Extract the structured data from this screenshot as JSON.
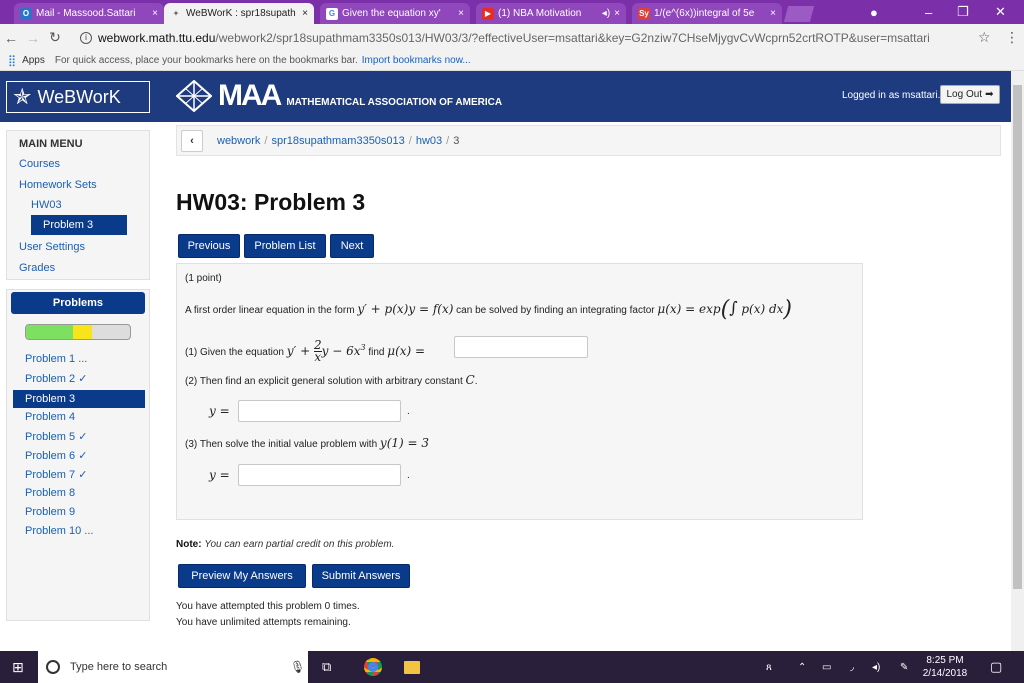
{
  "browser": {
    "tabs": [
      {
        "title": "Mail - Massood.Sattari",
        "icon": "outlook-icon"
      },
      {
        "title": "WeBWorK : spr18supath",
        "icon": "webwork-icon"
      },
      {
        "title": "Given the equation xy'",
        "icon": "google-icon"
      },
      {
        "title": "(1) NBA Motivation",
        "icon": "youtube-icon"
      },
      {
        "title": "1/(e^(6x))integral of 5e",
        "icon": "symbolab-icon"
      }
    ],
    "url_host": "webwork.math.ttu.edu",
    "url_path": "/webwork2/spr18supathmam3350s013/HW03/3/?effectiveUser=msattari&key=G2nziw7CHseMjygvCvWcprn52crtROTP&user=msattari",
    "bookmarks_apps": "Apps",
    "bookmarks_hint": "For quick access, place your bookmarks here on the bookmarks bar.",
    "bookmarks_link": "Import bookmarks now..."
  },
  "header": {
    "logo": "WeBWorK",
    "maa_big": "MAA",
    "maa_small": "MATHEMATICAL ASSOCIATION OF AMERICA",
    "logged_in": "Logged in as msattari.",
    "logout": "Log Out"
  },
  "sidebar": {
    "heading": "MAIN MENU",
    "courses": "Courses",
    "homework_sets": "Homework Sets",
    "hw03": "HW03",
    "problem3": "Problem 3",
    "user_settings": "User Settings",
    "grades": "Grades"
  },
  "problems_panel": {
    "heading": "Problems",
    "progress_correct": 0.45,
    "progress_partial": 0.18,
    "items": [
      "Problem 1 ...",
      "Problem 2 ✓",
      "Problem 3",
      "Problem 4",
      "Problem 5 ✓",
      "Problem 6 ✓",
      "Problem 7 ✓",
      "Problem 8",
      "Problem 9",
      "Problem 10 ..."
    ]
  },
  "breadcrumb": {
    "webwork": "webwork",
    "course": "spr18supathmam3350s013",
    "set": "hw03",
    "problem": "3"
  },
  "main": {
    "title": "HW03: Problem 3",
    "previous": "Previous",
    "problem_list": "Problem List",
    "next": "Next",
    "points": "(1 point)",
    "intro": "A first order linear equation in the form",
    "intro2": "can be solved by finding an integrating factor",
    "q1": "(1) Given the equation",
    "q1b": "find",
    "q2": "(2) Then find an explicit general solution with arbitrary constant",
    "q3": "(3) Then solve the initial value problem with",
    "answer1": "",
    "answer2": "",
    "answer3": "",
    "note_bold": "Note:",
    "note_text": "You can earn partial credit on this problem.",
    "preview": "Preview My Answers",
    "submit": "Submit Answers",
    "attempted": "You have attempted this problem 0 times.",
    "unlimited": "You have unlimited attempts remaining."
  },
  "taskbar": {
    "search_placeholder": "Type here to search",
    "time": "8:25 PM",
    "date": "2/14/2018"
  }
}
